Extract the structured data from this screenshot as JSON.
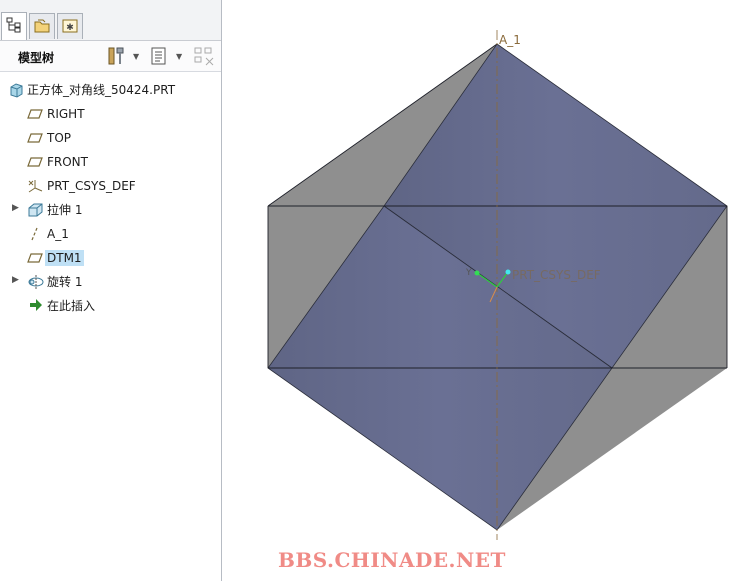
{
  "model_tree": {
    "title": "模型树",
    "items": [
      {
        "label": "正方体_对角线_50424.PRT",
        "icon": "part-icon",
        "expandable": false,
        "selected": false
      },
      {
        "label": "RIGHT",
        "icon": "datum-plane-icon",
        "expandable": false,
        "selected": false
      },
      {
        "label": "TOP",
        "icon": "datum-plane-icon",
        "expandable": false,
        "selected": false
      },
      {
        "label": "FRONT",
        "icon": "datum-plane-icon",
        "expandable": false,
        "selected": false
      },
      {
        "label": "PRT_CSYS_DEF",
        "icon": "coordinate-system-icon",
        "expandable": false,
        "selected": false
      },
      {
        "label": "拉伸 1",
        "icon": "extrude-icon",
        "expandable": true,
        "selected": false
      },
      {
        "label": "A_1",
        "icon": "datum-axis-icon",
        "expandable": false,
        "selected": false
      },
      {
        "label": "DTM1",
        "icon": "datum-plane-icon",
        "expandable": false,
        "selected": true
      },
      {
        "label": "旋转 1",
        "icon": "revolve-icon",
        "expandable": true,
        "selected": false
      },
      {
        "label": "在此插入",
        "icon": "insert-here-arrow-icon",
        "expandable": false,
        "selected": false
      }
    ]
  },
  "viewport": {
    "axis_label": "A_1",
    "csys_label": "PRT_CSYS_DEF",
    "watermark": "BBS.CHINADE.NET"
  },
  "colors": {
    "face_blue": "#646a8b",
    "face_gray": "#8f8f8f",
    "selection": "#bfe0f5",
    "watermark": "#f08b86"
  }
}
